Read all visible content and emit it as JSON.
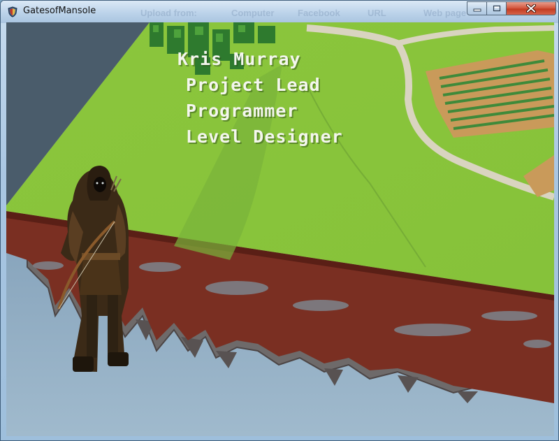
{
  "window": {
    "title": "GatesofMansole",
    "background_ghost_labels": [
      "Upload from:",
      "Computer",
      "Facebook",
      "URL",
      "Web page"
    ]
  },
  "credits": {
    "name": "Kris Murray",
    "roles": [
      "Project Lead",
      "Programmer",
      "Level Designer"
    ]
  },
  "icons": {
    "app": "game-shield-icon",
    "minimize": "minimize-icon",
    "maximize": "maximize-icon",
    "close": "close-icon"
  },
  "colors": {
    "grass": "#8ac43a",
    "dirt": "#7a2f22",
    "credit_text": "#f4f6ee",
    "close_button": "#c9432a"
  }
}
